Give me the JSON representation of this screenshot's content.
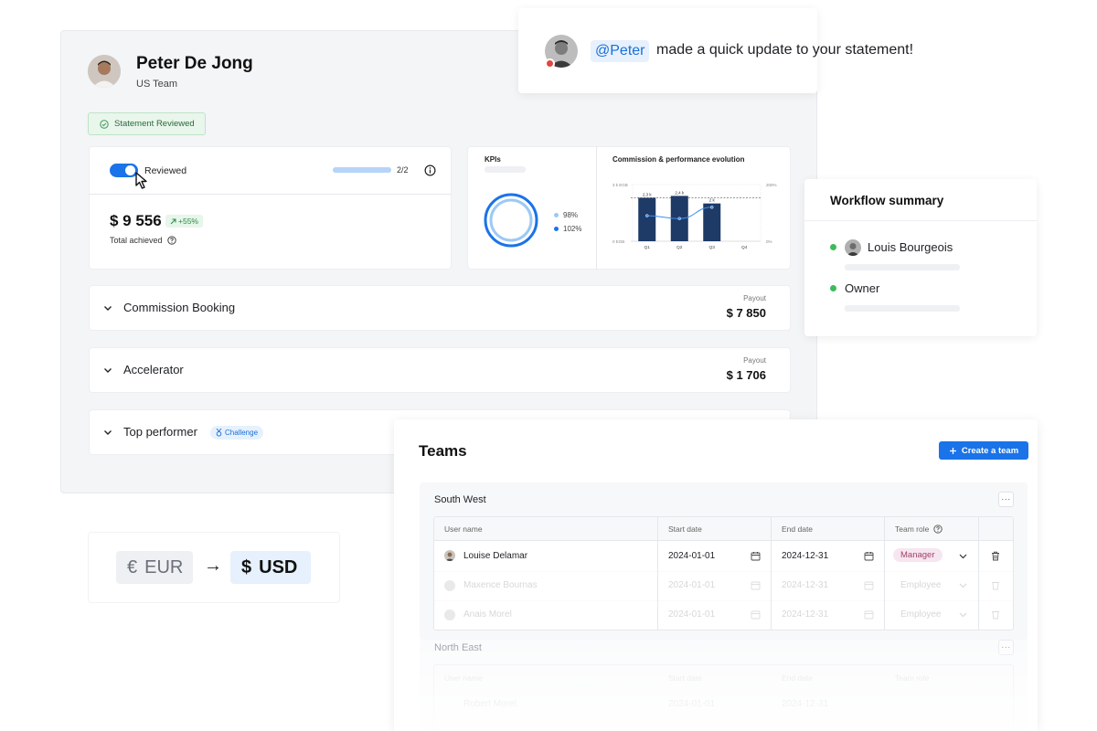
{
  "statement": {
    "user_name": "Peter De Jong",
    "team": "US Team",
    "status_badge": "Statement Reviewed",
    "review_toggle_label": "Reviewed",
    "review_progress_text": "2/2",
    "review_progress_fraction": 1.0,
    "total_amount": "$ 9 556",
    "total_delta": "+55%",
    "total_label": "Total achieved",
    "kpis_title": "KPIs",
    "kpi_legend": [
      "98%",
      "102%"
    ],
    "kpi_colors": [
      "#9cc9f5",
      "#1a73e8"
    ],
    "chart_title": "Commission & performance evolution",
    "rows": [
      {
        "title": "Commission Booking",
        "payout_label": "Payout",
        "payout_value": "$ 7 850"
      },
      {
        "title": "Accelerator",
        "payout_label": "Payout",
        "payout_value": "$ 1 706"
      },
      {
        "title": "Top performer",
        "badge": "Challenge"
      }
    ]
  },
  "chart_data": {
    "type": "bar",
    "title": "Commission & performance evolution",
    "categories": [
      "Q1",
      "Q2",
      "Q3",
      "Q4"
    ],
    "series": [
      {
        "values": [
          2.3,
          2.4,
          2.0,
          0
        ],
        "labels": [
          "2,3 k",
          "2,4 k",
          "2 k",
          ""
        ]
      },
      {
        "values": [
          90,
          80,
          120,
          null
        ]
      }
    ],
    "y_left_ticks": [
      "3 k EGB",
      "0 EGB"
    ],
    "y_right_ticks": [
      "200%",
      "0%"
    ],
    "ylim": [
      0,
      3
    ],
    "y2lim": [
      0,
      200
    ],
    "target_line": 2.3
  },
  "notification": {
    "mention": "@Peter",
    "message": "made a quick update to your statement!"
  },
  "workflow": {
    "title": "Workflow summary",
    "steps": [
      {
        "label": "Louis Bourgeois",
        "has_avatar": true
      },
      {
        "label": "Owner",
        "has_avatar": false
      }
    ]
  },
  "currency": {
    "from_symbol": "€",
    "from_code": "EUR",
    "arrow": "→",
    "to_symbol": "$",
    "to_code": "USD"
  },
  "teams": {
    "title": "Teams",
    "create_button": "Create a team",
    "headers": [
      "User name",
      "Start date",
      "End date",
      "Team role"
    ],
    "groups": [
      {
        "name": "South West",
        "menu": "···",
        "rows": [
          {
            "user": "Louise Delamar",
            "start": "2024-01-01",
            "end": "2024-12-31",
            "role": "Manager"
          },
          {
            "user": "Maxence Bournas",
            "start": "2024-01-01",
            "end": "2024-12-31",
            "role": "Employee"
          },
          {
            "user": "Anais Morel",
            "start": "2024-01-01",
            "end": "2024-12-31",
            "role": "Employee"
          }
        ]
      },
      {
        "name": "North East",
        "menu": "···",
        "rows": [
          {
            "user": "Robert Morel",
            "start": "2024-01-01",
            "end": "2024-12-31",
            "role": ""
          }
        ]
      }
    ],
    "role_colors": {
      "Manager": "#f7e6ef",
      "Manager_text": "#a0426f"
    }
  }
}
